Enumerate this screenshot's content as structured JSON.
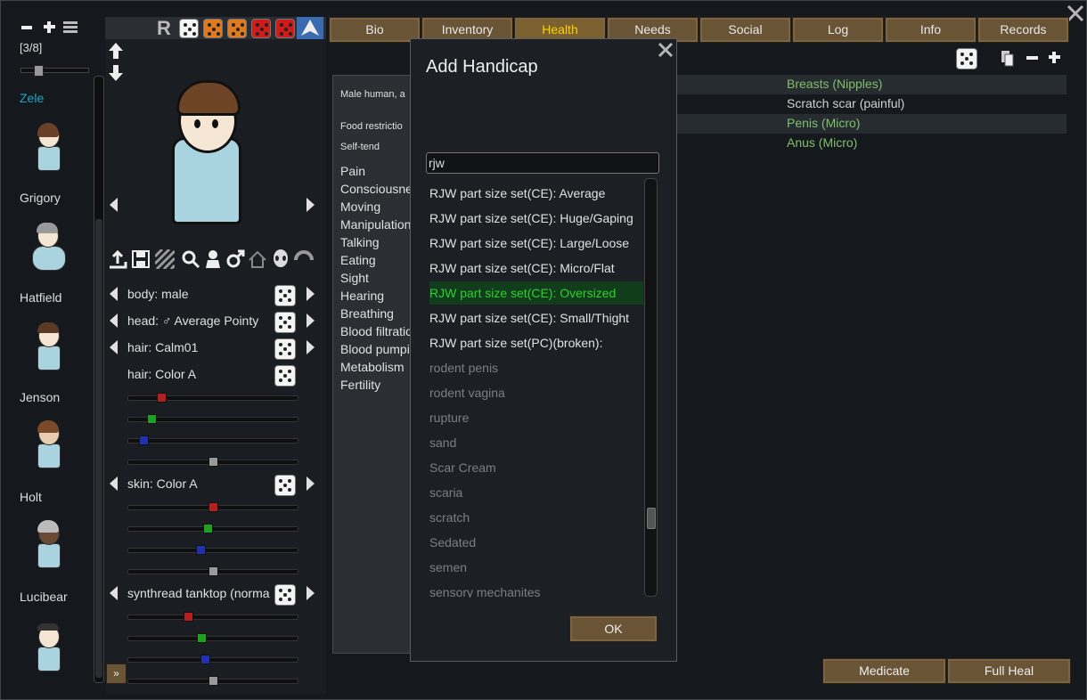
{
  "tabs": [
    {
      "label": "Bio",
      "active": false
    },
    {
      "label": "Inventory",
      "active": false
    },
    {
      "label": "Health",
      "active": true
    },
    {
      "label": "Needs",
      "active": false
    },
    {
      "label": "Social",
      "active": false
    },
    {
      "label": "Log",
      "active": false
    },
    {
      "label": "Info",
      "active": false
    },
    {
      "label": "Records",
      "active": false
    }
  ],
  "colonists": {
    "counter": "[3/8]",
    "names": [
      "Zele",
      "Grigory",
      "Hatfield",
      "Jenson",
      "Holt",
      "Lucibear"
    ],
    "selected": "Zele"
  },
  "toolbar": {
    "randomize_label": "R"
  },
  "editor": {
    "rows": {
      "body": "body: male",
      "head": "head: ♂ Average Pointy",
      "hair": "hair: Calm01",
      "hair_color": "hair: Color A",
      "skin_color": "skin: Color A",
      "apparel": "synthread tanktop (normal)"
    },
    "expand_label": "»"
  },
  "health": {
    "summary": "Male human, a",
    "food_restriction": "Food restrictio",
    "self_tend": "Self-tend",
    "capacities": [
      "Pain",
      "Consciousne",
      "Moving",
      "Manipulation",
      "Talking",
      "Eating",
      "Sight",
      "Hearing",
      "Breathing",
      "Blood filtratio",
      "Blood pumpi",
      "Metabolism",
      "Fertility"
    ]
  },
  "parts": [
    {
      "text": "Breasts (Nipples)",
      "color": "#7fbf6a"
    },
    {
      "text": "Scratch scar (painful)",
      "color": "#cfcfcf"
    },
    {
      "text": "Penis (Micro)",
      "color": "#7fbf6a"
    },
    {
      "text": "Anus (Micro)",
      "color": "#7fbf6a"
    }
  ],
  "buttons": {
    "medicate": "Medicate",
    "full_heal": "Full Heal"
  },
  "dialog": {
    "title": "Add Handicap",
    "search_value": "rjw",
    "ok_label": "OK",
    "options_enabled": [
      "RJW part size set(CE): Average",
      "RJW part size set(CE): Huge/Gaping",
      "RJW part size set(CE): Large/Loose",
      "RJW part size set(CE): Micro/Flat",
      "RJW part size set(CE): Oversized",
      "RJW part size set(CE): Small/Thight",
      "RJW part size set(PC)(broken):"
    ],
    "highlighted_index": 4,
    "options_disabled": [
      "rodent penis",
      "rodent vagina",
      "rupture",
      "sand",
      "Scar Cream",
      "scaria",
      "scratch",
      "Sedated",
      "semen",
      "sensory mechanites"
    ]
  },
  "colors": {
    "accent": "#ffd000",
    "selected_name": "#1fa7c4",
    "highlight_text": "#2ed12e"
  }
}
